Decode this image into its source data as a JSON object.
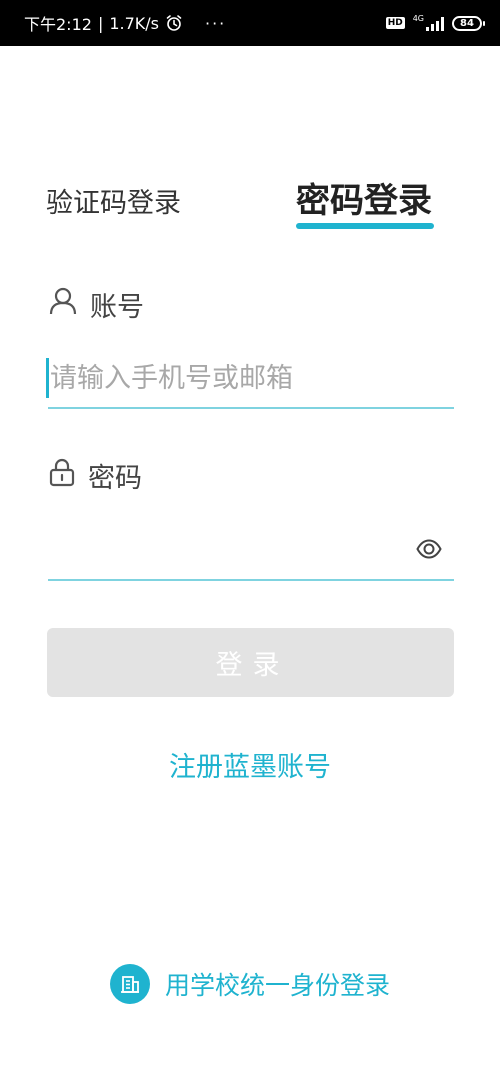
{
  "status_bar": {
    "time": "下午2:12",
    "speed": "1.7K/s",
    "more": "···",
    "hd": "HD",
    "network": "4G",
    "battery": "84"
  },
  "tabs": {
    "sms_login": "验证码登录",
    "password_login": "密码登录"
  },
  "form": {
    "account_label": "账号",
    "account_placeholder": "请输入手机号或邮箱",
    "password_label": "密码",
    "password_value": ""
  },
  "actions": {
    "login": "登录",
    "register": "注册蓝墨账号",
    "school_login": "用学校统一身份登录"
  },
  "colors": {
    "accent": "#1fb3cf",
    "disabled_button": "#e3e3e3"
  },
  "icons": {
    "account": "user-icon",
    "password": "lock-icon",
    "visibility": "eye-icon",
    "school": "school-building-icon",
    "alarm": "alarm-clock-icon"
  }
}
